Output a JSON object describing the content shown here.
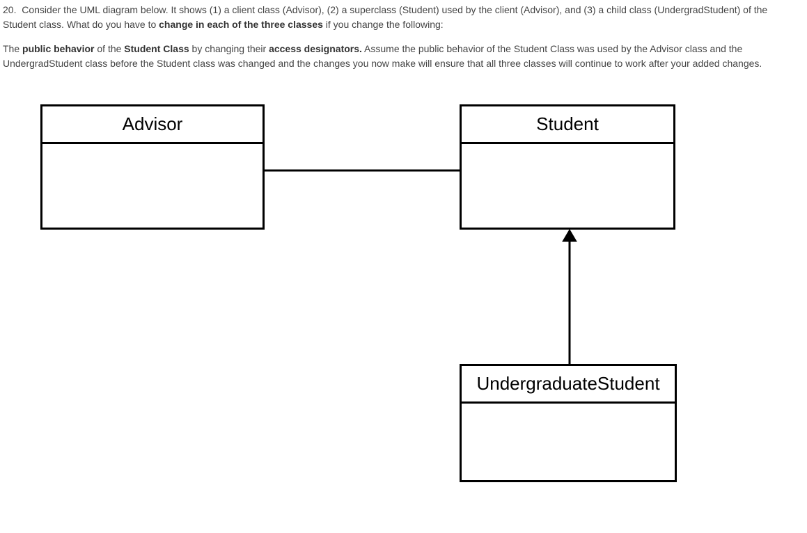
{
  "question": {
    "number": "20.",
    "intro": "Consider the UML diagram below. It shows (1) a client class (Advisor), (2) a superclass (Student) used by the client (Advisor), and (3) a child class (UndergradStudent) of the Student class. What do you have to",
    "intro_bold": "change in each of the three classes",
    "intro_tail": " if you change the following:",
    "para2_start": "The ",
    "para2_b1": "public behavior",
    "para2_mid1": " of the ",
    "para2_b2": "Student Class",
    "para2_mid2": " by changing their ",
    "para2_b3": "access designators.",
    "para2_tail": " Assume the public behavior of the Student Class was used by the Advisor class and the UndergradStudent class before the Student class was changed and the changes you now make will ensure that all three classes will continue to work after your added changes."
  },
  "uml": {
    "classes": {
      "advisor": {
        "name": "Advisor"
      },
      "student": {
        "name": "Student"
      },
      "undergrad": {
        "name": "UndergraduateStudent"
      }
    },
    "relationships": [
      {
        "from": "Advisor",
        "to": "Student",
        "type": "association"
      },
      {
        "from": "UndergraduateStudent",
        "to": "Student",
        "type": "generalization"
      }
    ]
  }
}
